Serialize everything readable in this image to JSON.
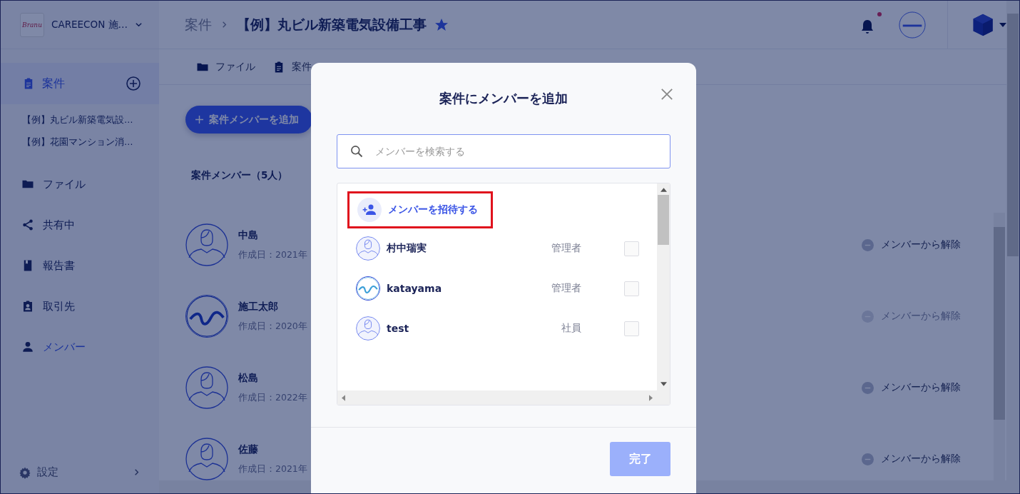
{
  "app": {
    "logo_text": "Branu",
    "company": "CAREECON 施…"
  },
  "sidebar": {
    "section": {
      "label": "案件",
      "selected": true,
      "projects": [
        "【例】丸ビル新築電気設…",
        "【例】花園マンション消…"
      ]
    },
    "items": [
      {
        "label": "ファイル",
        "kind": "folder",
        "selected": false
      },
      {
        "label": "共有中",
        "kind": "share",
        "selected": false
      },
      {
        "label": "報告書",
        "kind": "book",
        "selected": false
      },
      {
        "label": "取引先",
        "kind": "contact",
        "selected": false
      },
      {
        "label": "メンバー",
        "kind": "person",
        "selected": true
      }
    ],
    "settings": "設定"
  },
  "header": {
    "breadcrumb": "案件",
    "title": "【例】丸ビル新築電気設備工事",
    "starred": true,
    "unread_notifications": true
  },
  "tabs": [
    {
      "label": "ファイル",
      "kind": "folder"
    },
    {
      "label": "案件",
      "kind": "clipboard"
    }
  ],
  "content": {
    "add_button": "案件メンバーを追加",
    "member_count": "案件メンバー（5人）",
    "members": [
      {
        "name": "中島",
        "created": "作成日：2021年",
        "kind": "person",
        "remove": "メンバーから解除",
        "disabled": false
      },
      {
        "name": "施工太郎",
        "created": "作成日：2020年",
        "kind": "logo",
        "remove": "メンバーから解除",
        "disabled": true
      },
      {
        "name": "松島",
        "created": "作成日：2022年",
        "kind": "person",
        "remove": "メンバーから解除",
        "disabled": false
      },
      {
        "name": "佐藤",
        "created": "作成日：2021年",
        "kind": "person",
        "remove": "メンバーから解除",
        "disabled": false
      }
    ]
  },
  "modal": {
    "title": "案件にメンバーを追加",
    "search": {
      "placeholder": "メンバーを検索する"
    },
    "invite": {
      "label": "メンバーを招待する",
      "highlighted": true
    },
    "members": [
      {
        "name": "村中瑞実",
        "role": "管理者",
        "kind": "person",
        "checked": false
      },
      {
        "name": "katayama",
        "role": "管理者",
        "kind": "logo",
        "checked": false
      },
      {
        "name": "test",
        "role": "社員",
        "kind": "person",
        "checked": false
      }
    ],
    "done_button": {
      "label": "完了",
      "disabled": true
    }
  }
}
